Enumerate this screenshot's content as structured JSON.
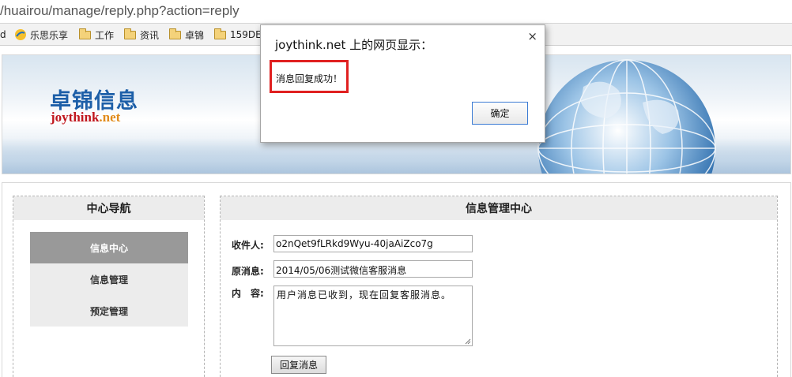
{
  "browser": {
    "url": "/huairou/manage/reply.php?action=reply",
    "bookmarks": [
      {
        "label": "d",
        "icon": "none"
      },
      {
        "label": "乐思乐享",
        "icon": "star-icon"
      },
      {
        "label": "工作",
        "icon": "folder-icon"
      },
      {
        "label": "资讯",
        "icon": "folder-icon"
      },
      {
        "label": "卓锦",
        "icon": "folder-icon"
      },
      {
        "label": "159DE",
        "icon": "folder-icon"
      }
    ]
  },
  "banner": {
    "logo_cn": "卓锦信息",
    "logo_en_main": "joythink",
    "logo_en_suffix": ".net"
  },
  "sidebar": {
    "title": "中心导航",
    "items": [
      {
        "label": "信息中心",
        "active": true
      },
      {
        "label": "信息管理",
        "active": false
      },
      {
        "label": "预定管理",
        "active": false
      }
    ]
  },
  "main": {
    "title": "信息管理中心",
    "recipient_label": "收件人:",
    "recipient_value": "o2nQet9fLRkd9Wyu-40jaAiZco7g",
    "original_label": "原消息:",
    "original_value": "2014/05/06测试微信客服消息",
    "content_label": "内　容:",
    "content_value": "用户消息已收到，现在回复客服消息。",
    "reply_button": "回复消息"
  },
  "dialog": {
    "title": "joythink.net 上的网页显示：",
    "message": "消息回复成功！",
    "ok_button": "确定",
    "close_symbol": "×"
  },
  "colors": {
    "logo_blue": "#1d5fa8",
    "logo_red": "#c0161d",
    "logo_orange": "#e18b1b",
    "nav_active": "#999999",
    "highlight_red": "#e02020"
  }
}
